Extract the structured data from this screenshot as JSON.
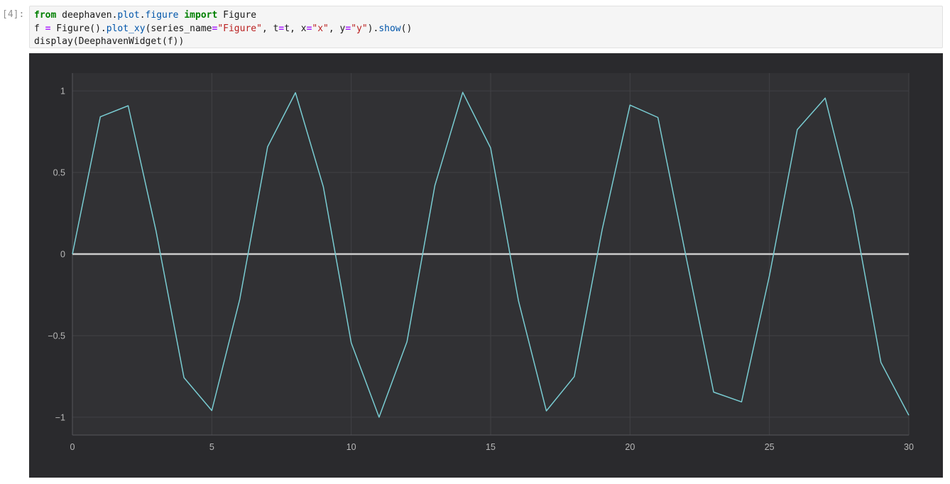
{
  "notebook": {
    "prompt": "[4]:",
    "code_lines": [
      [
        {
          "t": "from",
          "c": "kw"
        },
        {
          "t": " deephaven.",
          "c": "plain"
        },
        {
          "t": "plot",
          "c": "prop"
        },
        {
          "t": ".",
          "c": "plain"
        },
        {
          "t": "figure",
          "c": "prop"
        },
        {
          "t": " ",
          "c": "plain"
        },
        {
          "t": "import",
          "c": "kw"
        },
        {
          "t": " Figure",
          "c": "plain"
        }
      ],
      [
        {
          "t": "f ",
          "c": "plain"
        },
        {
          "t": "=",
          "c": "op"
        },
        {
          "t": " Figure().",
          "c": "plain"
        },
        {
          "t": "plot_xy",
          "c": "prop"
        },
        {
          "t": "(series_name",
          "c": "plain"
        },
        {
          "t": "=",
          "c": "op"
        },
        {
          "t": "\"Figure\"",
          "c": "str"
        },
        {
          "t": ", t",
          "c": "plain"
        },
        {
          "t": "=",
          "c": "op"
        },
        {
          "t": "t, x",
          "c": "plain"
        },
        {
          "t": "=",
          "c": "op"
        },
        {
          "t": "\"x\"",
          "c": "str"
        },
        {
          "t": ", y",
          "c": "plain"
        },
        {
          "t": "=",
          "c": "op"
        },
        {
          "t": "\"y\"",
          "c": "str"
        },
        {
          "t": ").",
          "c": "plain"
        },
        {
          "t": "show",
          "c": "prop"
        },
        {
          "t": "()",
          "c": "plain"
        }
      ],
      [
        {
          "t": "display(DeephavenWidget(f))",
          "c": "plain"
        }
      ]
    ]
  },
  "chart_data": {
    "type": "line",
    "title": "",
    "series": [
      {
        "name": "Figure",
        "x": [
          0,
          1,
          2,
          3,
          4,
          5,
          6,
          7,
          8,
          9,
          10,
          11,
          12,
          13,
          14,
          15,
          16,
          17,
          18,
          19,
          20,
          21,
          22,
          23,
          24,
          25,
          26,
          27,
          28,
          29,
          30
        ],
        "y": [
          0.0,
          0.841,
          0.909,
          0.141,
          -0.757,
          -0.959,
          -0.279,
          0.657,
          0.989,
          0.412,
          -0.544,
          -1.0,
          -0.537,
          0.42,
          0.991,
          0.65,
          -0.288,
          -0.961,
          -0.751,
          0.15,
          0.913,
          0.837,
          -0.009,
          -0.846,
          -0.906,
          -0.132,
          0.763,
          0.956,
          0.271,
          -0.664,
          -0.988
        ]
      }
    ],
    "x_ticks": {
      "values": [
        0,
        5,
        10,
        15,
        20,
        25,
        30
      ],
      "labels": [
        "0",
        "5",
        "10",
        "15",
        "20",
        "25",
        "30"
      ]
    },
    "y_ticks": {
      "values": [
        1,
        0.5,
        0,
        -0.5,
        -1
      ],
      "labels": [
        "1",
        "0.5",
        "0",
        "−0.5",
        "−1"
      ]
    },
    "xlim": [
      0,
      30
    ],
    "ylim": [
      -1.109,
      1.109
    ],
    "grid": true,
    "legend": "none",
    "xlabel": "",
    "ylabel": "",
    "colors": {
      "series_line": "#79ccd2",
      "zero_line": "#cbcbcb",
      "grid_line": "#414145",
      "axis_line": "#55555a",
      "tick_text": "#b8b8b8",
      "widget_bg": "#2a2a2d",
      "plot_bg": "#313134"
    }
  }
}
